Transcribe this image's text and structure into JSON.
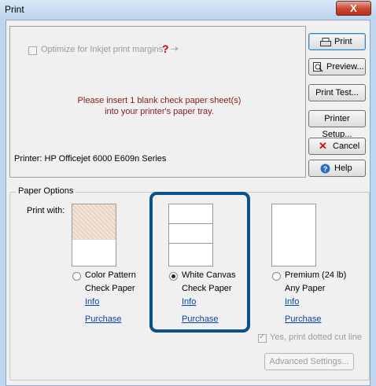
{
  "window": {
    "title": "Print",
    "close_label": "X"
  },
  "options": {
    "optimize_label": "Optimize for Inkjet print margins",
    "help_mark": "?"
  },
  "message": {
    "line1": "Please insert 1 blank check paper sheet(s)",
    "line2": "into your printer's paper tray."
  },
  "printer_label": "Printer: HP Officejet 6000 E609n Series",
  "buttons": {
    "print": "Print",
    "preview": "Preview...",
    "print_test": "Print Test...",
    "printer_setup": "Printer Setup...",
    "cancel": "Cancel",
    "help": "Help"
  },
  "paper_options": {
    "group_label": "Paper Options",
    "print_with_label": "Print with:",
    "choices": [
      {
        "line1": "Color Pattern",
        "line2": "Check Paper",
        "info": "Info",
        "purchase": "Purchase",
        "selected": false
      },
      {
        "line1": "White Canvas",
        "line2": "Check Paper",
        "info": "Info",
        "purchase": "Purchase",
        "selected": true
      },
      {
        "line1": "Premium (24 lb)",
        "line2": "Any Paper",
        "info": "Info",
        "purchase": "Purchase",
        "selected": false
      }
    ],
    "cut_line_label": "Yes, print dotted cut line",
    "advanced_label": "Advanced Settings..."
  },
  "colors": {
    "highlight": "#0b4f8c",
    "message": "#8b1a1a",
    "link": "#0645ad"
  }
}
